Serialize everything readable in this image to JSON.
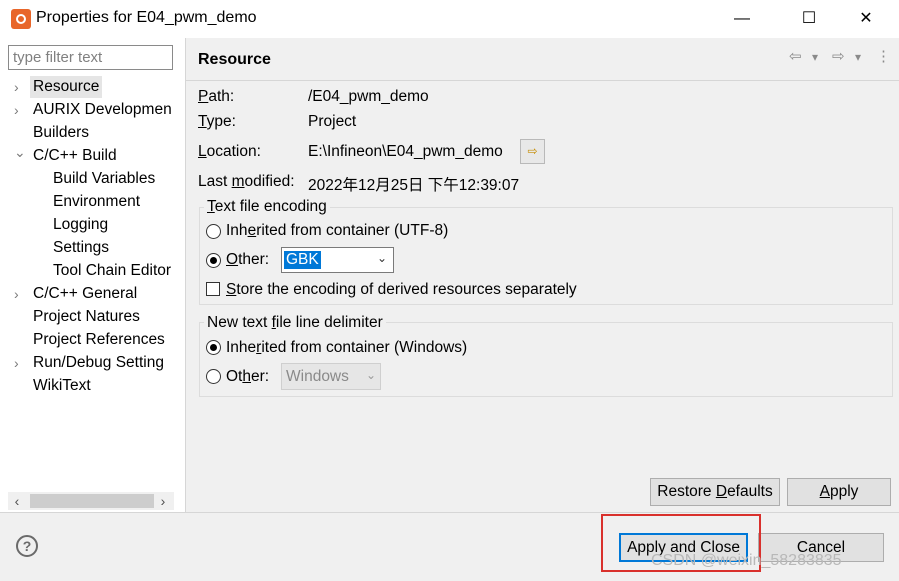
{
  "window": {
    "title": "Properties for E04_pwm_demo",
    "controls": [
      "—",
      "☐",
      "✕"
    ]
  },
  "filter": {
    "placeholder": "type filter text"
  },
  "tree": [
    {
      "label": "Resource",
      "chevron": "›",
      "selected": true
    },
    {
      "label": "AURIX Developmen",
      "chevron": "›"
    },
    {
      "label": "Builders",
      "chevron": ""
    },
    {
      "label": "C/C++ Build",
      "chevron": "⌄"
    },
    {
      "label": "Build Variables",
      "chevron": ""
    },
    {
      "label": "Environment",
      "chevron": ""
    },
    {
      "label": "Logging",
      "chevron": ""
    },
    {
      "label": "Settings",
      "chevron": ""
    },
    {
      "label": "Tool Chain Editor",
      "chevron": ""
    },
    {
      "label": "C/C++ General",
      "chevron": "›"
    },
    {
      "label": "Project Natures",
      "chevron": ""
    },
    {
      "label": "Project References",
      "chevron": ""
    },
    {
      "label": "Run/Debug Setting",
      "chevron": "›"
    },
    {
      "label": "WikiText",
      "chevron": ""
    }
  ],
  "header": {
    "title": "Resource",
    "nav": {
      "back": "⇦",
      "back_menu": "▾",
      "forward": "⇨",
      "forward_menu": "▾",
      "more": "⋮"
    }
  },
  "resource": {
    "path_label_u": "P",
    "path_label_rest": "ath:",
    "path_value": "/E04_pwm_demo",
    "type_label_u": "T",
    "type_label_rest": "ype:",
    "type_value": "Project",
    "location_label_u": "L",
    "location_label_rest": "ocation:",
    "location_value": "E:\\Infineon\\E04_pwm_demo",
    "modified_label_pre": "Last ",
    "modified_label_u": "m",
    "modified_label_rest": "odified:",
    "modified_value": "2022年12月25日 下午12:39:07"
  },
  "encoding": {
    "legend_u": "T",
    "legend_rest": "ext file encoding",
    "inherited_pre": "Inh",
    "inherited_u": "e",
    "inherited_rest": "rited from container (UTF-8)",
    "other_pre": "",
    "other_u": "O",
    "other_rest": "ther:",
    "other_value": "GBK",
    "store_u": "S",
    "store_rest": "tore the encoding of derived resources separately",
    "inherited_selected": false,
    "other_selected": true,
    "store_checked": false
  },
  "delimiter": {
    "legend_pre": "New text ",
    "legend_u": "f",
    "legend_rest": "ile line delimiter",
    "inherited_pre": "Inhe",
    "inherited_u": "r",
    "inherited_rest": "ited from container (Windows)",
    "other_pre": "Ot",
    "other_u": "h",
    "other_rest": "er:",
    "other_value": "Windows",
    "inherited_selected": true,
    "other_selected": false
  },
  "buttons": {
    "restore_pre": "Restore ",
    "restore_u": "D",
    "restore_rest": "efaults",
    "apply_u": "A",
    "apply_rest": "pply",
    "apply_close": "Apply and Close",
    "cancel": "Cancel",
    "help": "?"
  },
  "scrollbar": {
    "left": "‹",
    "right": "›"
  },
  "watermark": "CSDN @weixin_58283835",
  "colors": {
    "accent": "#0078d7",
    "highlight_box": "#d9302c",
    "app_icon": "#e8662a"
  }
}
